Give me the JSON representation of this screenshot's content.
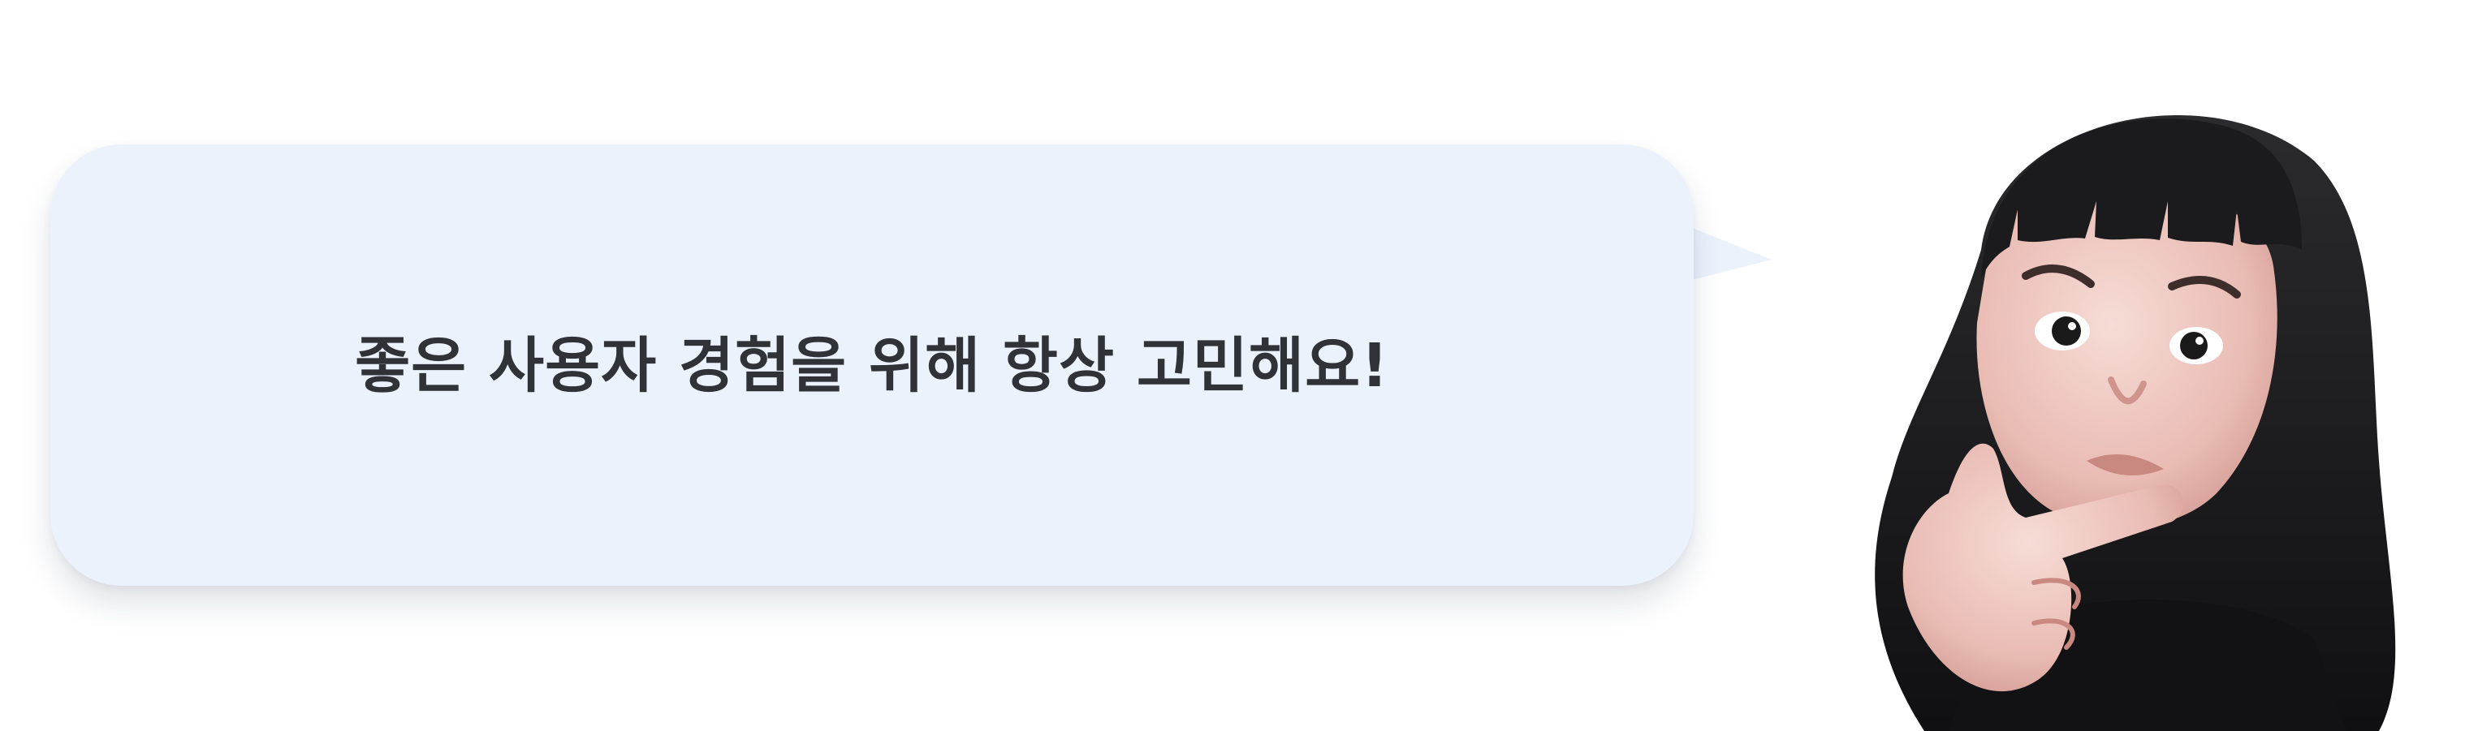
{
  "speech_bubble": {
    "message": "좋은 사용자 경험을 위해 항상 고민해요!",
    "background_color": "#ebf2fc",
    "text_color": "#2f3237"
  },
  "avatar": {
    "icon": "thinking-memoji-icon"
  }
}
